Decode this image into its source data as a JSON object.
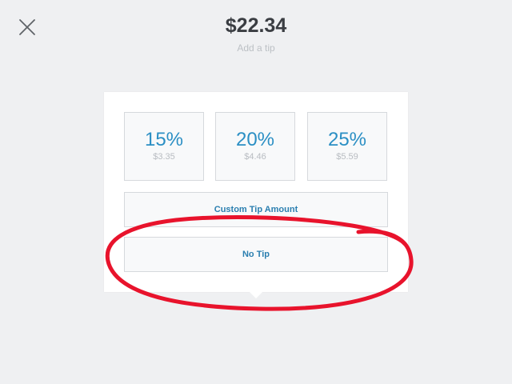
{
  "header": {
    "total": "$22.34",
    "subtitle": "Add a tip",
    "close_icon": "close-icon"
  },
  "tip_options": [
    {
      "percent": "15%",
      "amount": "$3.35"
    },
    {
      "percent": "20%",
      "amount": "$4.46"
    },
    {
      "percent": "25%",
      "amount": "$5.59"
    }
  ],
  "custom_tip_label": "Custom Tip Amount",
  "no_tip_label": "No Tip",
  "colors": {
    "accent": "#2b8fc4",
    "annotation": "#e8132c",
    "background": "#eff0f2"
  }
}
